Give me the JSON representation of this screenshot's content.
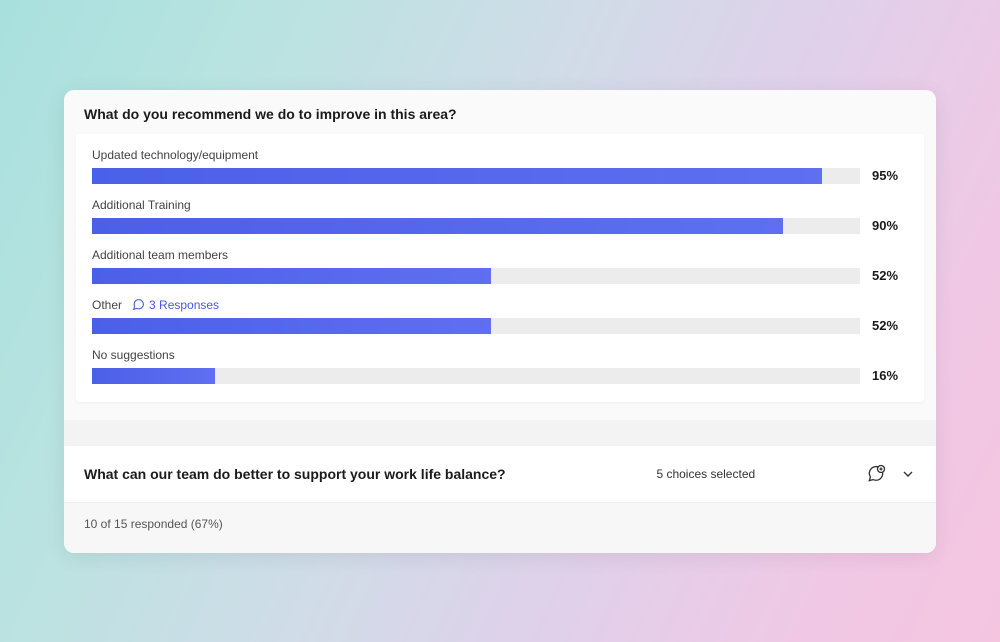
{
  "question1": {
    "title": "What do you recommend we do to improve in this area?",
    "options": {
      "opt0": {
        "label": "Updated technology/equipment",
        "pct": "95%"
      },
      "opt1": {
        "label": "Additional Training",
        "pct": "90%"
      },
      "opt2": {
        "label": "Additional team members",
        "pct": "52%"
      },
      "opt3": {
        "label": "Other",
        "responses_link": "3 Responses",
        "pct": "52%"
      },
      "opt4": {
        "label": "No suggestions",
        "pct": "16%"
      }
    }
  },
  "question2": {
    "title": "What can our team do better to support your work life balance?",
    "choices_text": "5 choices selected"
  },
  "footer": {
    "responded": "10 of 15 responded (67%)"
  },
  "chart_data": {
    "type": "bar",
    "title": "What do you recommend we do to improve in this area?",
    "xlabel": "",
    "ylabel": "",
    "ylim": [
      0,
      100
    ],
    "categories": [
      "Updated technology/equipment",
      "Additional Training",
      "Additional team members",
      "Other",
      "No suggestions"
    ],
    "values": [
      95,
      90,
      52,
      52,
      16
    ]
  }
}
